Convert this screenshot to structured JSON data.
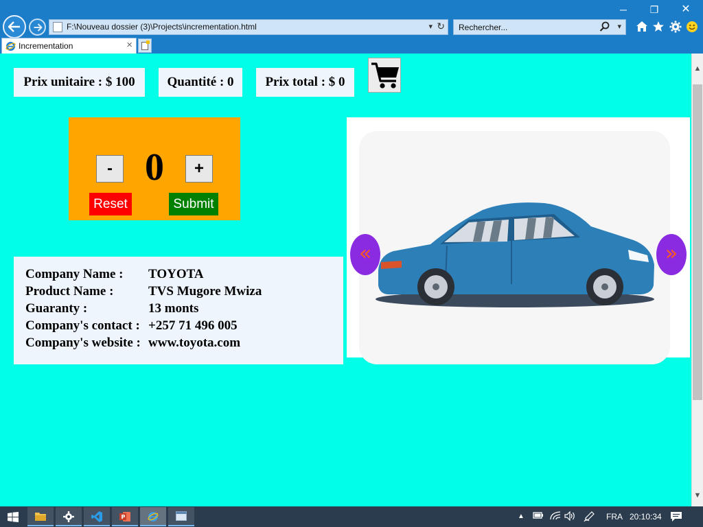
{
  "browser": {
    "address": "F:\\Nouveau dossier (3)\\Projects\\incrementation.html",
    "search_placeholder": "Rechercher...",
    "tab_title": "Incrementation",
    "window_controls": {
      "minimize": "─",
      "maximize": "❐",
      "close": "✕"
    },
    "toolbar_icons": [
      "home-icon",
      "favorites-star-icon",
      "gear-icon",
      "smiley-icon"
    ]
  },
  "page": {
    "unit_price": "Prix unitaire : $ 100",
    "quantity": "Quantité : 0",
    "total_price": "Prix total : $ 0",
    "counter": {
      "minus_label": "-",
      "value": "0",
      "plus_label": "+",
      "reset_label": "Reset",
      "submit_label": "Submit"
    },
    "company": {
      "rows": [
        {
          "key": "Company Name :",
          "value": "TOYOTA"
        },
        {
          "key": "Product Name :",
          "value": "TVS Mugore Mwiza"
        },
        {
          "key": "Guaranty :",
          "value": "13 monts"
        },
        {
          "key": "Company's contact :",
          "value": "+257 71 496 005"
        },
        {
          "key": "Company's website :",
          "value": "www.toyota.com"
        }
      ]
    },
    "slider": {
      "prev_label": "«",
      "next_label": "»",
      "image": "blue-sedan-car"
    },
    "colors": {
      "page_background": "#00ffe6",
      "counter_panel": "#ffa500",
      "reset": "#ff0000",
      "submit": "#008000",
      "slider_arrows": "#8a2be2"
    }
  },
  "taskbar": {
    "apps": [
      "file-explorer",
      "settings",
      "vscode",
      "powerpoint",
      "internet-explorer",
      "window"
    ],
    "language": "FRA",
    "time": "20:10:34"
  }
}
